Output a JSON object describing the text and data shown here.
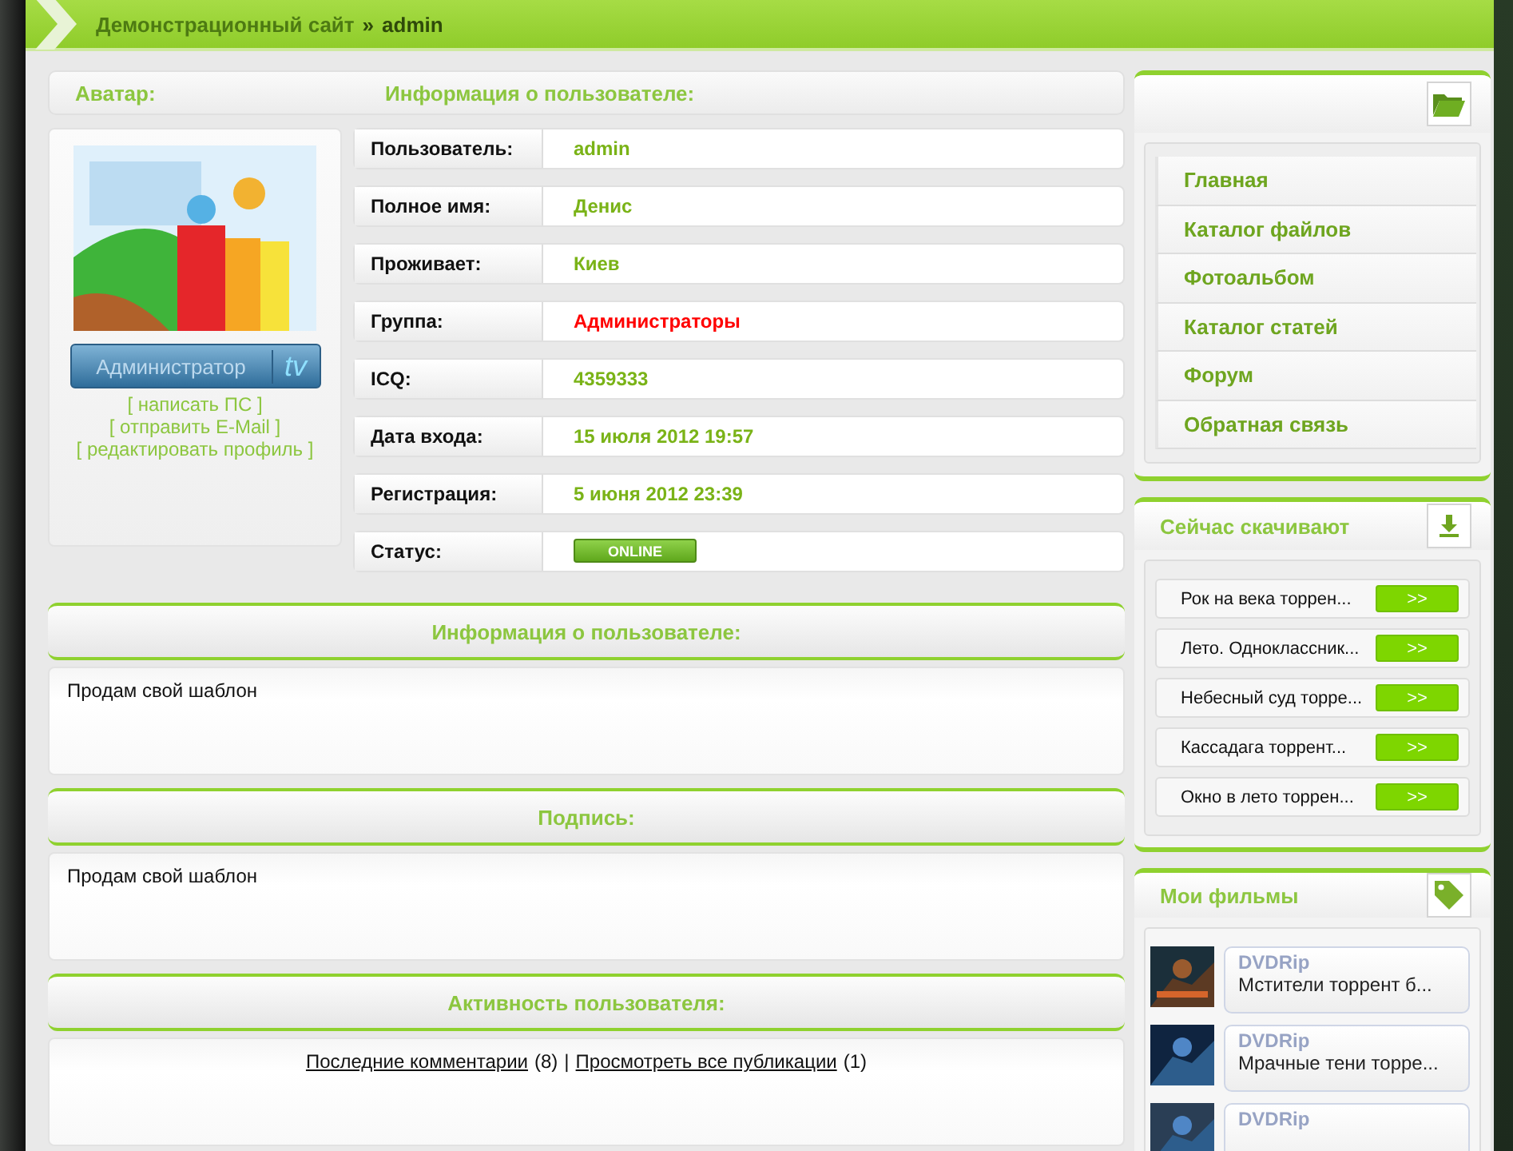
{
  "breadcrumb": {
    "site": "Демонстрационный сайт",
    "separator": "»",
    "current": "admin"
  },
  "profile_header": {
    "avatar_title": "Аватар:",
    "info_title": "Информация о пользователе:"
  },
  "avatar": {
    "kind": "picture",
    "rank_badge": {
      "label": "Администратор",
      "suffix": "tv"
    },
    "links": [
      "[ написать ПС ]",
      "[ отправить E-Mail ]",
      "[ редактировать профиль ]"
    ]
  },
  "fields": [
    {
      "label": "Пользователь:",
      "kind": "text",
      "value": "admin",
      "color": "#7ab317"
    },
    {
      "label": "Полное имя:",
      "kind": "text",
      "value": "Денис",
      "color": "#7ab317"
    },
    {
      "label": "Проживает:",
      "kind": "text",
      "value": "Киев",
      "color": "#7ab317"
    },
    {
      "label": "Группа:",
      "kind": "text",
      "value": "Администраторы",
      "color": "#ff0000"
    },
    {
      "label": "ICQ:",
      "kind": "text",
      "value": "4359333",
      "color": "#7ab317"
    },
    {
      "label": "Дата входа:",
      "kind": "text",
      "value": "15 июля 2012 19:57",
      "color": "#7ab317"
    },
    {
      "label": "Регистрация:",
      "kind": "text",
      "value": "5 июня 2012 23:39",
      "color": "#7ab317"
    },
    {
      "label": "Статус:",
      "kind": "badge",
      "value": "ONLINE",
      "color": "#5fa81c"
    }
  ],
  "sections": [
    {
      "title": "Информация о пользователе:",
      "kind": "text",
      "text": "Продам свой шаблон"
    },
    {
      "title": "Подпись:",
      "kind": "text",
      "text": "Продам свой шаблон"
    },
    {
      "title": "Активность пользователя:",
      "kind": "activity",
      "separator": "|",
      "items": [
        {
          "link": "Последние комментарии",
          "count": "(8)"
        },
        {
          "link": "Просмотреть все публикации",
          "count": "(1)"
        }
      ]
    }
  ],
  "sidebar": {
    "menu": {
      "items": [
        "Главная",
        "Каталог файлов",
        "Фотоальбом",
        "Каталог статей",
        "Форум",
        "Обратная связь"
      ]
    },
    "downloads": {
      "title": "Сейчас скачивают",
      "items": [
        {
          "title": "Рок на века торрен...",
          "button": ">>"
        },
        {
          "title": "Лето. Одноклассник...",
          "button": ">>"
        },
        {
          "title": "Небесный суд торре...",
          "button": ">>"
        },
        {
          "title": "Кассадага торрент...",
          "button": ">>"
        },
        {
          "title": "Окно в лето торрен...",
          "button": ">>"
        }
      ]
    },
    "films": {
      "title": "Мои фильмы",
      "items": [
        {
          "quality": "DVDRip",
          "title": "Мстители торрент б..."
        },
        {
          "quality": "DVDRip",
          "title": "Мрачные тени торре..."
        },
        {
          "quality": "DVDRip"
        }
      ]
    }
  }
}
